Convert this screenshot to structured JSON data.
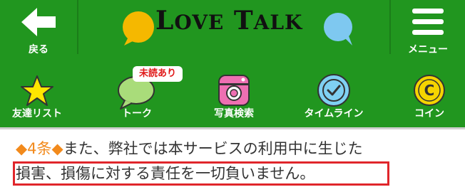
{
  "header": {
    "back_label": "戻る",
    "logo_text_big1": "L",
    "logo_text_small1": "OVE",
    "logo_text_big2": " T",
    "logo_text_small2": "ALK",
    "menu_label": "メニュー",
    "bubble_colors": [
      "#f5b800",
      "#7ec8f0"
    ]
  },
  "tabs": [
    {
      "label": "友達リスト",
      "icon": "star-icon",
      "color": "#ffe600"
    },
    {
      "label": "トーク",
      "icon": "speech-bubble-icon",
      "color": "#a9dc7a"
    },
    {
      "label": "写真検索",
      "icon": "camera-icon",
      "color": "#ee6fb2"
    },
    {
      "label": "タイムライン",
      "icon": "clock-icon",
      "color": "#7fd0f2"
    },
    {
      "label": "コイン",
      "icon": "coin-icon",
      "color": "#f5d400"
    }
  ],
  "talk_badge": "未読あり",
  "content": {
    "diamond_left": "◆",
    "article_no": "4条",
    "diamond_right": "◆",
    "line1_text": "また、弊社では本サービスの利用中に生じた",
    "line2_text": "損害、損傷に対する責任を一切負いません。"
  }
}
